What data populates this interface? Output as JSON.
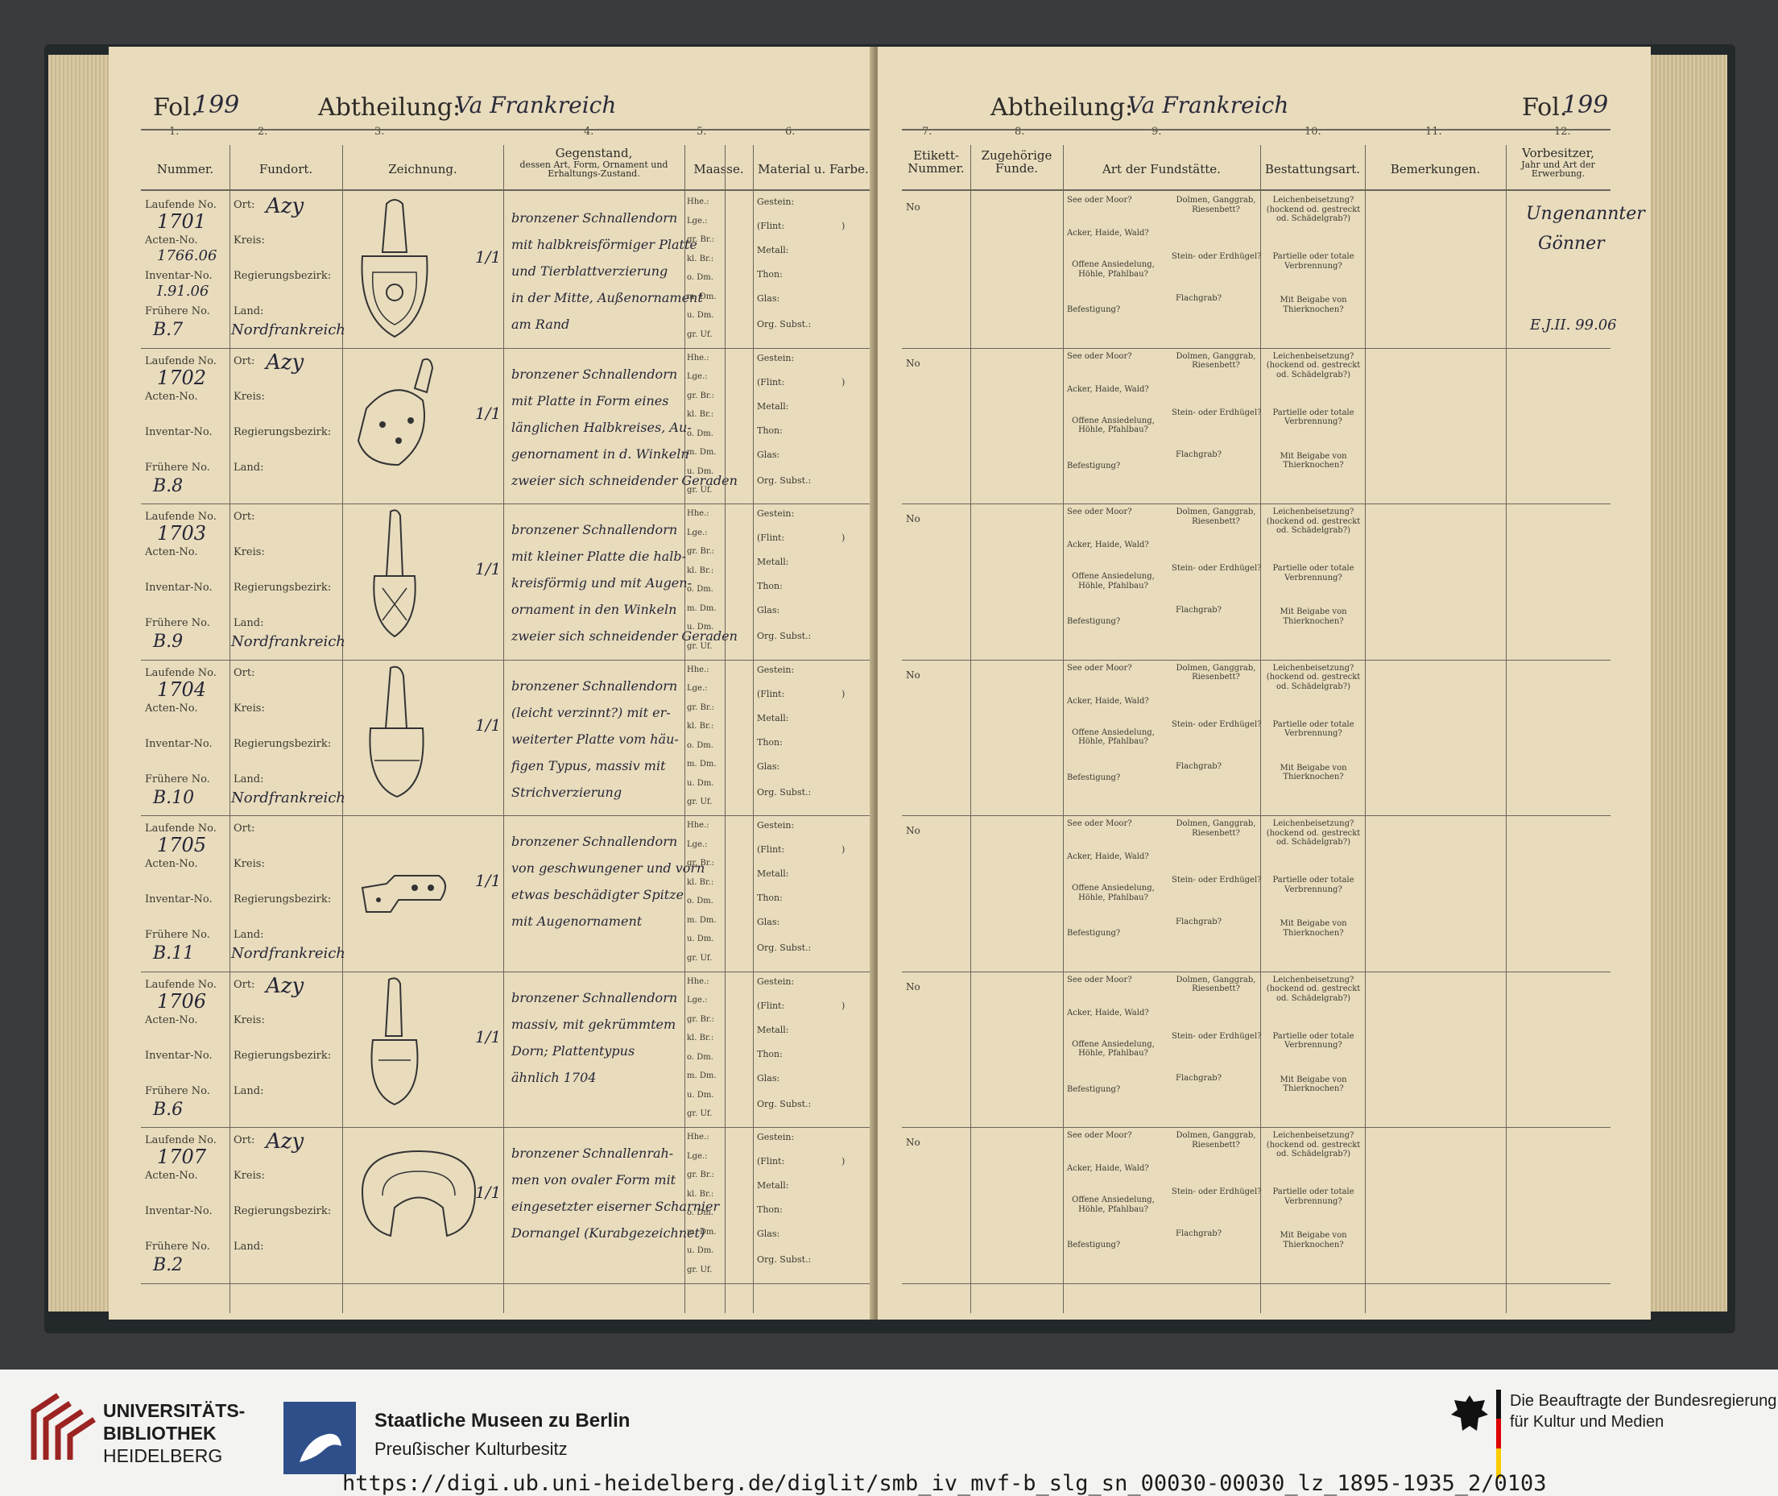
{
  "left_page": {
    "fol_label": "Fol.",
    "fol_number": "199",
    "abtheilung_label": "Abtheilung:",
    "abtheilung_value": "Va Frankreich",
    "col_numbers": [
      "1.",
      "2.",
      "3.",
      "4.",
      "5.",
      "6."
    ],
    "headers": {
      "nummer": "Nummer.",
      "fundort": "Fundort.",
      "zeichnung": "Zeichnung.",
      "gegenstand": "Gegenstand,",
      "gegenstand_sub": "dessen Art, Form, Ornament und Erhaltungs-Zustand.",
      "maasse": "Maasse.",
      "material": "Material u. Farbe."
    }
  },
  "right_page": {
    "fol_label": "Fol.",
    "fol_number": "199",
    "abtheilung_label": "Abtheilung:",
    "abtheilung_value": "Va Frankreich",
    "col_numbers": [
      "7.",
      "8.",
      "9.",
      "10.",
      "11.",
      "12."
    ],
    "headers": {
      "etikett": "Etikett-Nummer.",
      "zugehoerige": "Zugehörige Funde.",
      "fundstaette": "Art der Fundstätte.",
      "bestattung": "Bestattungsart.",
      "bemerkungen": "Bemerkungen.",
      "vorbesitzer": "Vorbesitzer,",
      "vorbesitzer_sub": "Jahr und Art der Erwerbung."
    },
    "vorbesitzer_entry": {
      "line1": "Ungenannter",
      "line2": "Gönner",
      "line3": "E.J.II. 99.06"
    }
  },
  "labels": {
    "laufende": "Laufende No.",
    "acten": "Acten-No.",
    "inventar": "Inventar-No.",
    "fruehere": "Frühere No.",
    "ort": "Ort:",
    "kreis": "Kreis:",
    "regbez": "Regierungsbezirk:",
    "land": "Land:",
    "maasse": [
      "Hhe.:",
      "Lge.:",
      "gr. Br.:",
      "kl. Br.:",
      "o. Dm.",
      "m. Dm.",
      "u. Dm.",
      "gr. Uf."
    ],
    "material": [
      "Gestein:",
      "(Flint:",
      ")",
      "Metall:",
      "Thon:",
      "Glas:",
      "Org. Subst.:"
    ],
    "etikett_no": "No",
    "fund1": "See oder Moor?",
    "fund2": "Acker, Haide, Wald?",
    "fund3": "Offene Ansiedelung, Höhle, Pfahlbau?",
    "fund4": "Befestigung?",
    "fund5": "Dolmen, Ganggrab, Riesenbett?",
    "fund6": "Stein- oder Erdhügel?",
    "fund7": "Flachgrab?",
    "best1": "Leichenbeisetzung? (hockend od. gestreckt od. Schädelgrab?)",
    "best2": "Partielle oder totale Verbrennung?",
    "best3": "Mit Beigabe von Thierknochen?"
  },
  "rows": [
    {
      "laufende": "1701",
      "acten": "1766.06",
      "inventar": "I.91.06",
      "fruehere": "B.7",
      "ort": "Azy",
      "land": "Nordfrankreich",
      "scale": "1/1",
      "desc": [
        "bronzener Schnallendorn",
        "mit halbkreisförmiger Platte",
        "und Tierblattverzierung",
        "in der Mitte, Außenornament",
        "am Rand"
      ]
    },
    {
      "laufende": "1702",
      "acten": "",
      "inventar": "",
      "fruehere": "B.8",
      "ort": "Azy",
      "land": "",
      "scale": "1/1",
      "desc": [
        "bronzener Schnallendorn",
        "mit Platte in Form eines",
        "länglichen Halbkreises, Au-",
        "genornament in d. Winkeln",
        "zweier sich schneidender Geraden"
      ]
    },
    {
      "laufende": "1703",
      "acten": "",
      "inventar": "",
      "fruehere": "B.9",
      "ort": "",
      "land": "Nordfrankreich",
      "scale": "1/1",
      "desc": [
        "bronzener Schnallendorn",
        "mit kleiner Platte die halb-",
        "kreisförmig und mit Augen-",
        "ornament in den Winkeln",
        "zweier sich schneidender Geraden"
      ]
    },
    {
      "laufende": "1704",
      "acten": "",
      "inventar": "",
      "fruehere": "B.10",
      "ort": "",
      "land": "Nordfrankreich",
      "scale": "1/1",
      "desc": [
        "bronzener Schnallendorn",
        "(leicht verzinnt?) mit er-",
        "weiterter Platte vom häu-",
        "figen Typus, massiv mit",
        "Strichverzierung"
      ]
    },
    {
      "laufende": "1705",
      "acten": "",
      "inventar": "",
      "fruehere": "B.11",
      "ort": "",
      "land": "Nordfrankreich",
      "scale": "1/1",
      "desc": [
        "bronzener Schnallendorn",
        "von geschwungener und vorn",
        "etwas beschädigter Spitze",
        "mit Augenornament"
      ]
    },
    {
      "laufende": "1706",
      "acten": "",
      "inventar": "",
      "fruehere": "B.6",
      "ort": "Azy",
      "land": "",
      "scale": "1/1",
      "desc": [
        "bronzener Schnallendorn",
        "massiv, mit gekrümmtem",
        "Dorn; Plattentypus",
        "ähnlich 1704"
      ]
    },
    {
      "laufende": "1707",
      "acten": "",
      "inventar": "",
      "fruehere": "B.2",
      "ort": "Azy",
      "land": "",
      "scale": "1/1",
      "desc": [
        "bronzener Schnallenrah-",
        "men von ovaler Form mit",
        "eingesetzter eiserner Scharnier",
        "Dornangel (Kurabgezeichnet)"
      ]
    }
  ],
  "footer": {
    "ub_line1": "UNIVERSITÄTS-",
    "ub_line2": "BIBLIOTHEK",
    "ub_line3": "HEIDELBERG",
    "smb_line1": "Staatliche Museen zu Berlin",
    "smb_line2": "Preußischer Kulturbesitz",
    "bkm_line1": "Die Beauftragte der Bundesregierung",
    "bkm_line2": "für Kultur und Medien",
    "url": "https://digi.ub.uni-heidelberg.de/diglit/smb_iv_mvf-b_slg_sn_00030-00030_lz_1895-1935_2/0103"
  },
  "colors": {
    "paper": "#e8dcbd",
    "ink": "#262636",
    "ub_red": "#9b2423",
    "smb_blue": "#2f4f8a"
  }
}
